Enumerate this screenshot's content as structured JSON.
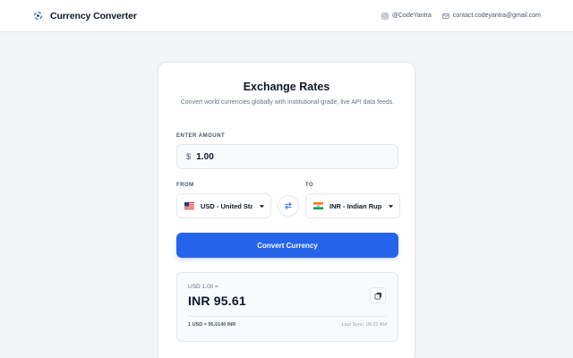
{
  "header": {
    "app_name": "Currency Converter",
    "instagram": "@CodeYantra",
    "email": "contact.codeyantra@gmail.com"
  },
  "card": {
    "title": "Exchange Rates",
    "subtitle": "Convert world currencies globally with institutional-grade, live API data feeds."
  },
  "amount": {
    "label": "ENTER AMOUNT",
    "symbol": "$",
    "value": "1.00"
  },
  "from": {
    "label": "FROM",
    "selected": "USD - United States Dollar",
    "flag": "us-flag-icon"
  },
  "to": {
    "label": "TO",
    "selected": "INR - Indian Rupee",
    "flag": "india-flag-icon"
  },
  "convert_label": "Convert Currency",
  "result": {
    "from_text": "USD 1.00 =",
    "value": "INR 95.61",
    "rate": "1 USD = 95.6140 INR",
    "last_sync": "Last Sync: 05:32 AM"
  },
  "colors": {
    "accent": "#2563eb",
    "background": "#f3f5f8",
    "card": "#ffffff"
  }
}
